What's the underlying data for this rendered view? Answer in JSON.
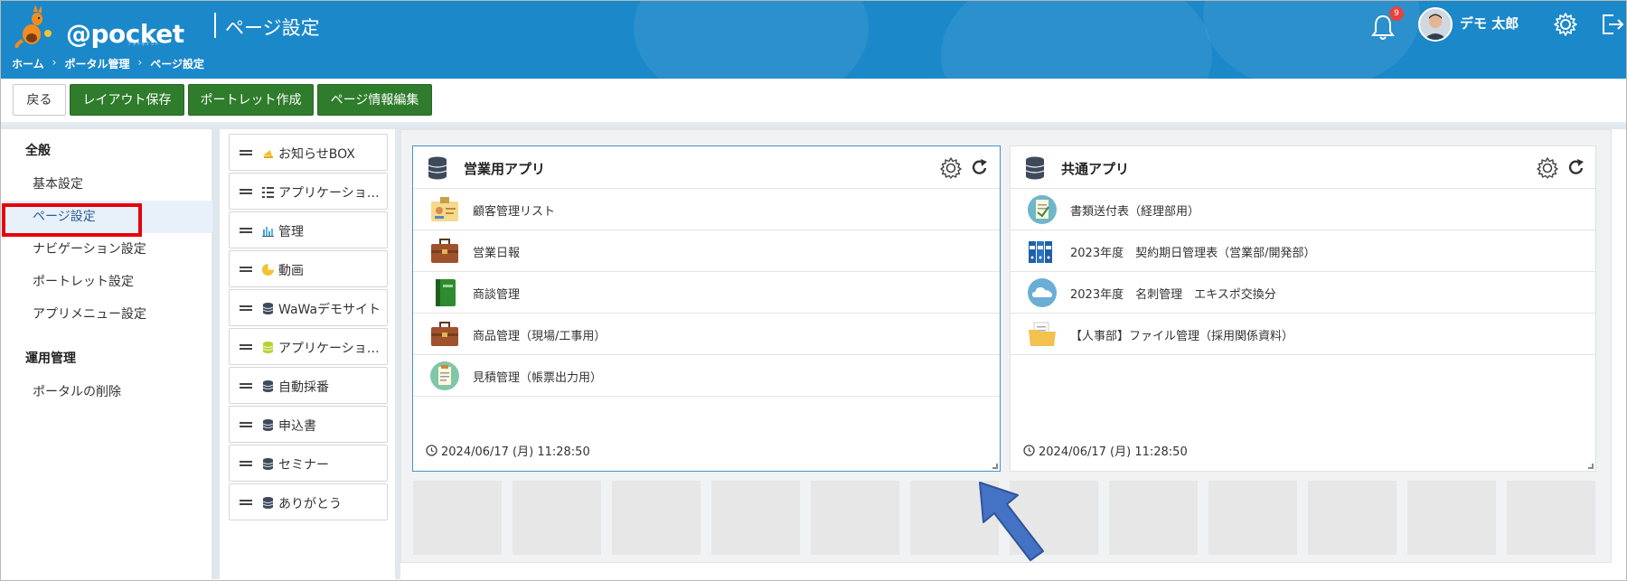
{
  "header": {
    "logo_text": "@pocket",
    "logo_sub": "アットポケット",
    "page_title": "ページ設定",
    "breadcrumb": [
      "ホーム",
      "ポータル管理",
      "ページ設定"
    ],
    "breadcrumb_sep": "›",
    "notification_count": "9",
    "user_name": "デモ 太郎",
    "bg_color": "#1b88c9"
  },
  "toolbar": {
    "back_label": "戻る",
    "buttons": [
      "レイアウト保存",
      "ポートレット作成",
      "ページ情報編集"
    ],
    "button_color": "#2f7c2c"
  },
  "sidebar": {
    "sections": [
      {
        "heading": "全般",
        "items": [
          "基本設定",
          "ページ設定",
          "ナビゲーション設定",
          "ポートレット設定",
          "アプリメニュー設定"
        ]
      },
      {
        "heading": "運用管理",
        "items": [
          "ポータルの削除"
        ]
      }
    ],
    "active_item": "ページ設定",
    "highlight_color": "#e8000b"
  },
  "portlets": [
    {
      "label": "お知らせBOX",
      "icon": "megaphone-icon"
    },
    {
      "label": "アプリケーション一覧",
      "icon": "list-icon"
    },
    {
      "label": "管理",
      "icon": "bar-chart-icon"
    },
    {
      "label": "動画",
      "icon": "pie-chart-icon"
    },
    {
      "label": "WaWaデモサイト",
      "icon": "database-icon"
    },
    {
      "label": "アプリケーション一覧",
      "icon": "database-green-icon"
    },
    {
      "label": "自動採番",
      "icon": "database-icon"
    },
    {
      "label": "申込書",
      "icon": "database-icon"
    },
    {
      "label": "セミナー",
      "icon": "database-icon"
    },
    {
      "label": "ありがとう",
      "icon": "database-icon"
    }
  ],
  "cards": [
    {
      "title": "営業用アプリ",
      "items": [
        {
          "label": "顧客管理リスト",
          "icon": "contact-card-icon"
        },
        {
          "label": "営業日報",
          "icon": "briefcase-icon"
        },
        {
          "label": "商談管理",
          "icon": "notebook-icon"
        },
        {
          "label": "商品管理（現場/工事用）",
          "icon": "briefcase-icon"
        },
        {
          "label": "見積管理（帳票出力用）",
          "icon": "clipboard-icon"
        }
      ],
      "timestamp": "2024/06/17 (月) 11:28:50"
    },
    {
      "title": "共通アプリ",
      "items": [
        {
          "label": "書類送付表（経理部用）",
          "icon": "document-icon"
        },
        {
          "label": "2023年度　契約期日管理表（営業部/開発部）",
          "icon": "binders-icon"
        },
        {
          "label": "2023年度　名刺管理　エキスポ交換分",
          "icon": "cloud-icon"
        },
        {
          "label": "【人事部】ファイル管理（採用関係資料）",
          "icon": "folder-icon"
        }
      ],
      "timestamp": "2024/06/17 (月) 11:28:50"
    }
  ],
  "annotation": {
    "arrow_color": "#4472c4"
  }
}
